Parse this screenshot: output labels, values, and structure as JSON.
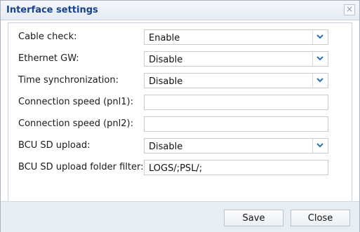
{
  "dialog": {
    "title": "Interface settings",
    "close_icon": "close-icon"
  },
  "form": {
    "fields": [
      {
        "label": "Cable check:",
        "type": "select",
        "value": "Enable"
      },
      {
        "label": "Ethernet GW:",
        "type": "select",
        "value": "Disable"
      },
      {
        "label": "Time synchronization:",
        "type": "select",
        "value": "Disable"
      },
      {
        "label": "Connection speed (pnl1):",
        "type": "text",
        "value": ""
      },
      {
        "label": "Connection speed (pnl2):",
        "type": "text",
        "value": ""
      },
      {
        "label": "BCU SD upload:",
        "type": "select",
        "value": "Disable"
      },
      {
        "label": "BCU SD upload folder filter:",
        "type": "text",
        "value": "LOGS/;PSL/;"
      }
    ]
  },
  "footer": {
    "save_label": "Save",
    "close_label": "Close"
  },
  "colors": {
    "title_text": "#15428b",
    "dropdown_chevron": "#2a6fb0",
    "footer_bg": "#e8edf2"
  }
}
